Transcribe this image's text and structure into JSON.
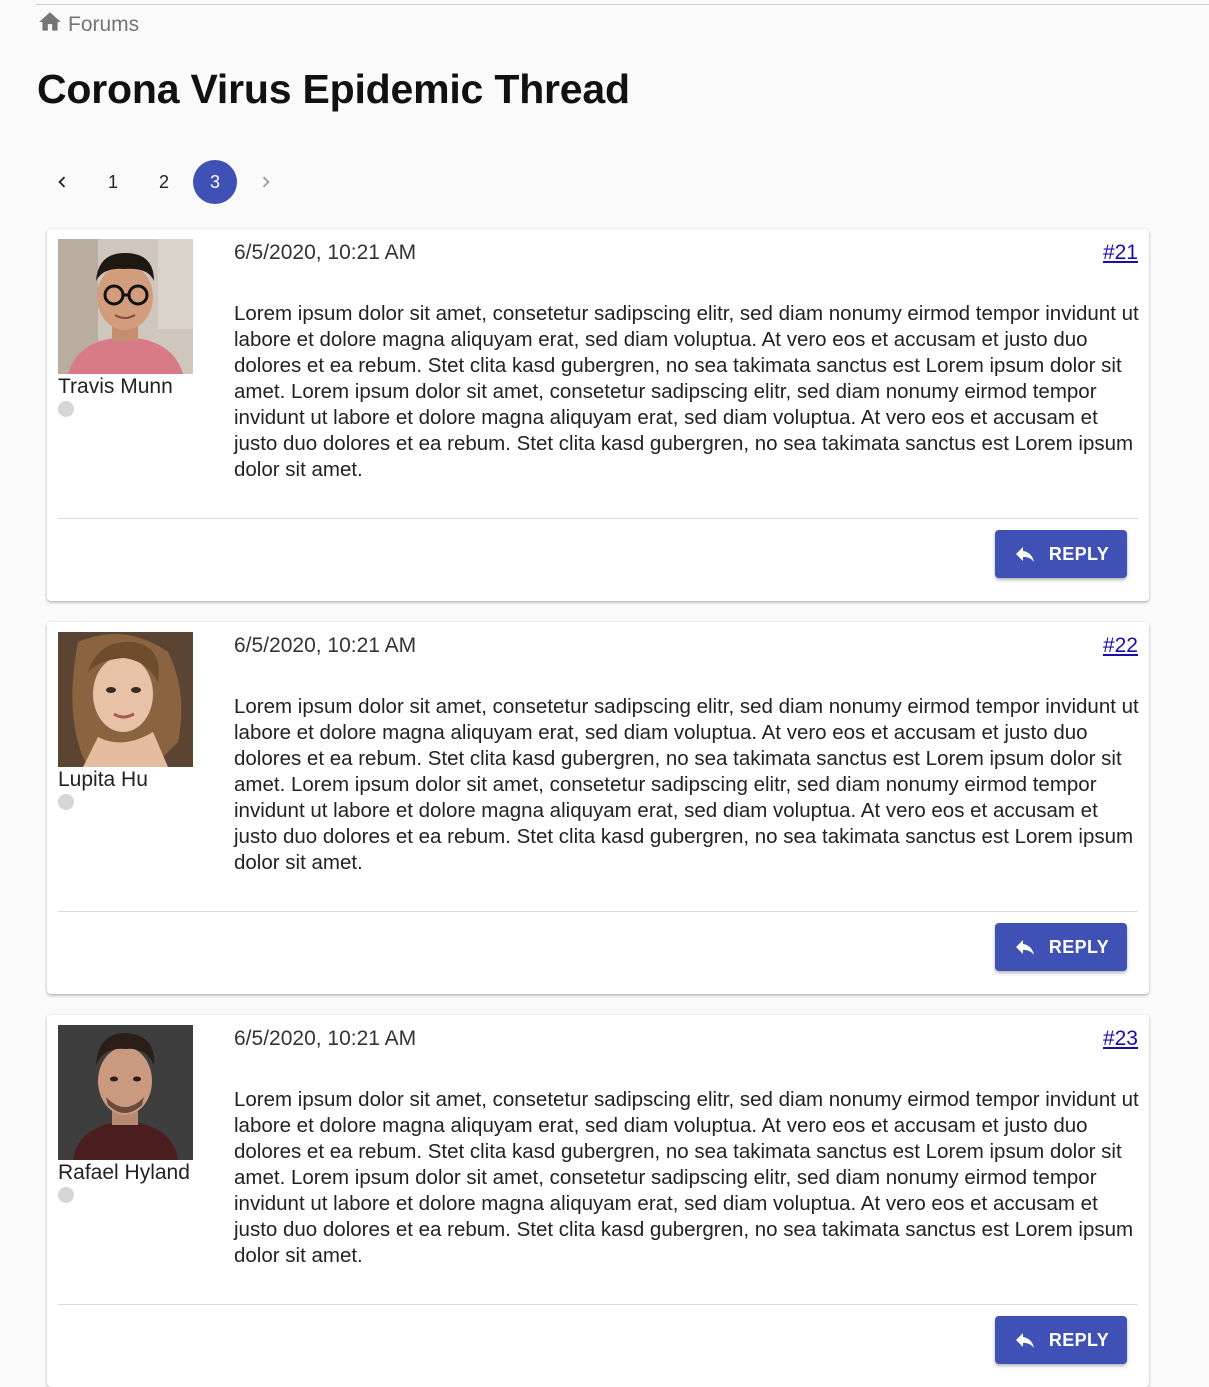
{
  "breadcrumb": {
    "icon": "home-icon",
    "label": "Forums"
  },
  "page_title": "Corona Virus Epidemic Thread",
  "pagination": {
    "pages": [
      "1",
      "2",
      "3"
    ],
    "current": "3",
    "prev_icon": "chevron-left-icon",
    "next_icon": "chevron-right-icon"
  },
  "accent_color": "#3f51b5",
  "posts": [
    {
      "author": "Travis Munn",
      "date": "6/5/2020, 10:21 AM",
      "number": "#21",
      "body": "Lorem ipsum dolor sit amet, consetetur sadipscing elitr, sed diam nonumy eirmod tempor invidunt ut labore et dolore magna aliquyam erat, sed diam voluptua. At vero eos et accusam et justo duo dolores et ea rebum. Stet clita kasd gubergren, no sea takimata sanctus est Lorem ipsum dolor sit amet. Lorem ipsum dolor sit amet, consetetur sadipscing elitr, sed diam nonumy eirmod tempor invidunt ut labore et dolore magna aliquyam erat, sed diam voluptua. At vero eos et accusam et justo duo dolores et ea rebum. Stet clita kasd gubergren, no sea takimata sanctus est Lorem ipsum dolor sit amet.",
      "reply_label": "REPLY"
    },
    {
      "author": "Lupita Hu",
      "date": "6/5/2020, 10:21 AM",
      "number": "#22",
      "body": "Lorem ipsum dolor sit amet, consetetur sadipscing elitr, sed diam nonumy eirmod tempor invidunt ut labore et dolore magna aliquyam erat, sed diam voluptua. At vero eos et accusam et justo duo dolores et ea rebum. Stet clita kasd gubergren, no sea takimata sanctus est Lorem ipsum dolor sit amet. Lorem ipsum dolor sit amet, consetetur sadipscing elitr, sed diam nonumy eirmod tempor invidunt ut labore et dolore magna aliquyam erat, sed diam voluptua. At vero eos et accusam et justo duo dolores et ea rebum. Stet clita kasd gubergren, no sea takimata sanctus est Lorem ipsum dolor sit amet.",
      "reply_label": "REPLY"
    },
    {
      "author": "Rafael Hyland",
      "date": "6/5/2020, 10:21 AM",
      "number": "#23",
      "body": "Lorem ipsum dolor sit amet, consetetur sadipscing elitr, sed diam nonumy eirmod tempor invidunt ut labore et dolore magna aliquyam erat, sed diam voluptua. At vero eos et accusam et justo duo dolores et ea rebum. Stet clita kasd gubergren, no sea takimata sanctus est Lorem ipsum dolor sit amet. Lorem ipsum dolor sit amet, consetetur sadipscing elitr, sed diam nonumy eirmod tempor invidunt ut labore et dolore magna aliquyam erat, sed diam voluptua. At vero eos et accusam et justo duo dolores et ea rebum. Stet clita kasd gubergren, no sea takimata sanctus est Lorem ipsum dolor sit amet.",
      "reply_label": "REPLY"
    }
  ]
}
